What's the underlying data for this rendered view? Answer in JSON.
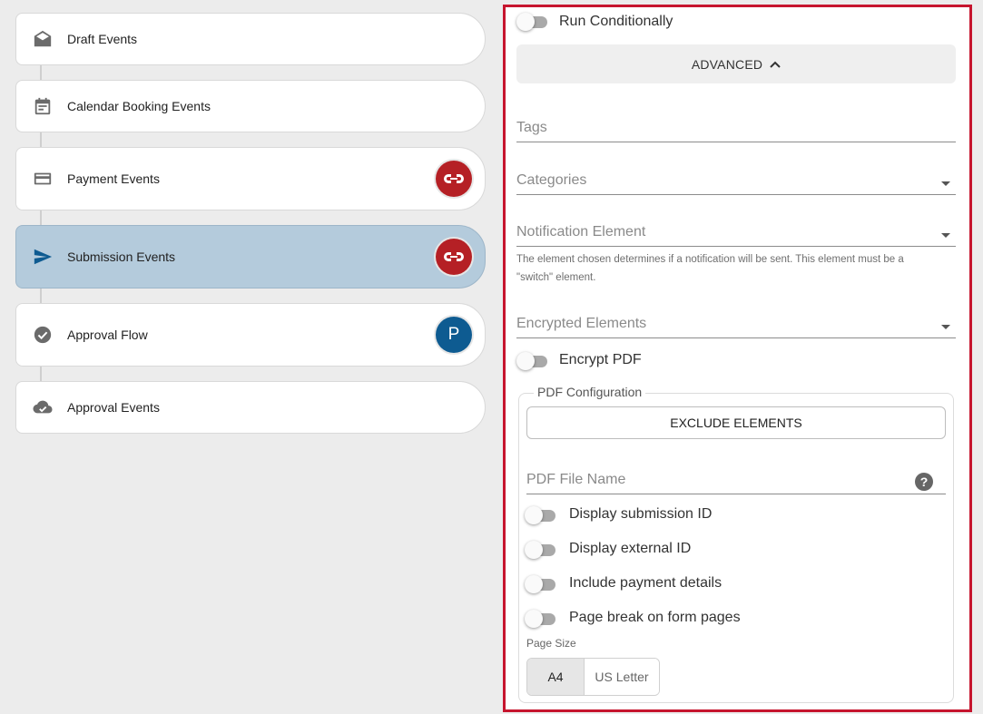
{
  "events": [
    {
      "label": "Draft Events",
      "icon": "envelope-open-icon",
      "badge": null,
      "active": false
    },
    {
      "label": "Calendar Booking Events",
      "icon": "calendar-icon",
      "badge": null,
      "active": false
    },
    {
      "label": "Payment Events",
      "icon": "credit-card-icon",
      "badge": "red-link",
      "active": false
    },
    {
      "label": "Submission Events",
      "icon": "send-icon",
      "badge": "red-link",
      "active": true
    },
    {
      "label": "Approval Flow",
      "icon": "check-circle-icon",
      "badge": "P",
      "active": false
    },
    {
      "label": "Approval Events",
      "icon": "cloud-check-icon",
      "badge": null,
      "active": false
    }
  ],
  "panel": {
    "run_conditionally": "Run Conditionally",
    "advanced": "ADVANCED",
    "tags": "Tags",
    "categories": "Categories",
    "notification_element": "Notification Element",
    "notification_hint": "The element chosen determines if a notification will be sent. This element must be a \"switch\" element.",
    "encrypted_elements": "Encrypted Elements",
    "encrypt_pdf": "Encrypt PDF",
    "pdf_config": {
      "legend": "PDF Configuration",
      "exclude_elements": "EXCLUDE ELEMENTS",
      "file_name_placeholder": "PDF File Name",
      "help": "?",
      "toggles": [
        "Display submission ID",
        "Display external ID",
        "Include payment details",
        "Page break on form pages"
      ],
      "page_size_label": "Page Size",
      "page_sizes": [
        "A4",
        "US Letter"
      ],
      "selected_page_size": "A4"
    }
  },
  "colors": {
    "accent_red": "#c6152e",
    "badge_red": "#b52025",
    "badge_blue": "#0e5b91",
    "active_card": "#b4cbdc",
    "send_icon": "#0e5b91"
  }
}
